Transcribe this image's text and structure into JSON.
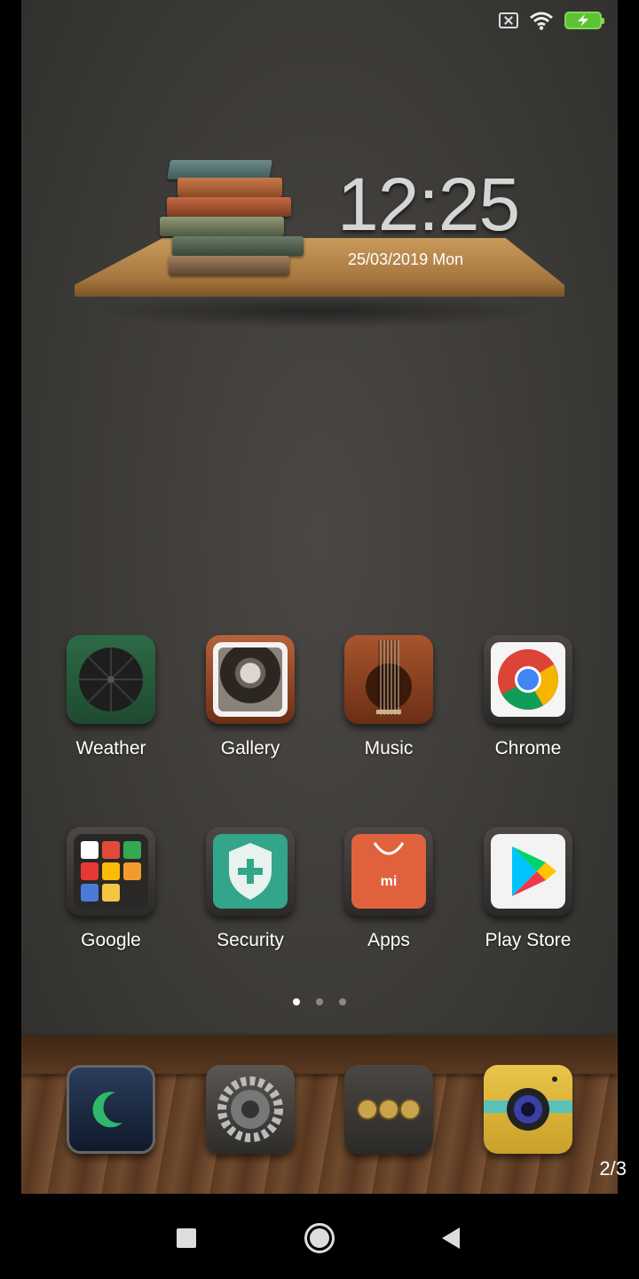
{
  "status_bar": {
    "icons": [
      "no-sim-icon",
      "wifi-icon",
      "battery-charging-icon"
    ],
    "battery_color": "#5cc233"
  },
  "clock_widget": {
    "time": "12:25",
    "date": "25/03/2019 Mon"
  },
  "apps": [
    {
      "label": "Weather",
      "icon": "umbrella-icon"
    },
    {
      "label": "Gallery",
      "icon": "portrait-photo-icon"
    },
    {
      "label": "Music",
      "icon": "guitar-icon"
    },
    {
      "label": "Chrome",
      "icon": "chrome-icon"
    },
    {
      "label": "Google",
      "icon": "google-folder-icon"
    },
    {
      "label": "Security",
      "icon": "shield-plus-icon"
    },
    {
      "label": "Apps",
      "icon": "mi-shopping-bag-icon"
    },
    {
      "label": "Play Store",
      "icon": "play-triangle-icon"
    }
  ],
  "page_indicator": {
    "pages": 3,
    "current": 1
  },
  "dock": [
    {
      "icon": "phone-moon-icon"
    },
    {
      "icon": "gear-settings-icon"
    },
    {
      "icon": "dial-counter-icon"
    },
    {
      "icon": "camera-icon"
    }
  ],
  "page_counter": "2/3",
  "nav_bar": {
    "buttons": [
      "recents-square-icon",
      "home-circle-icon",
      "back-triangle-icon"
    ]
  }
}
